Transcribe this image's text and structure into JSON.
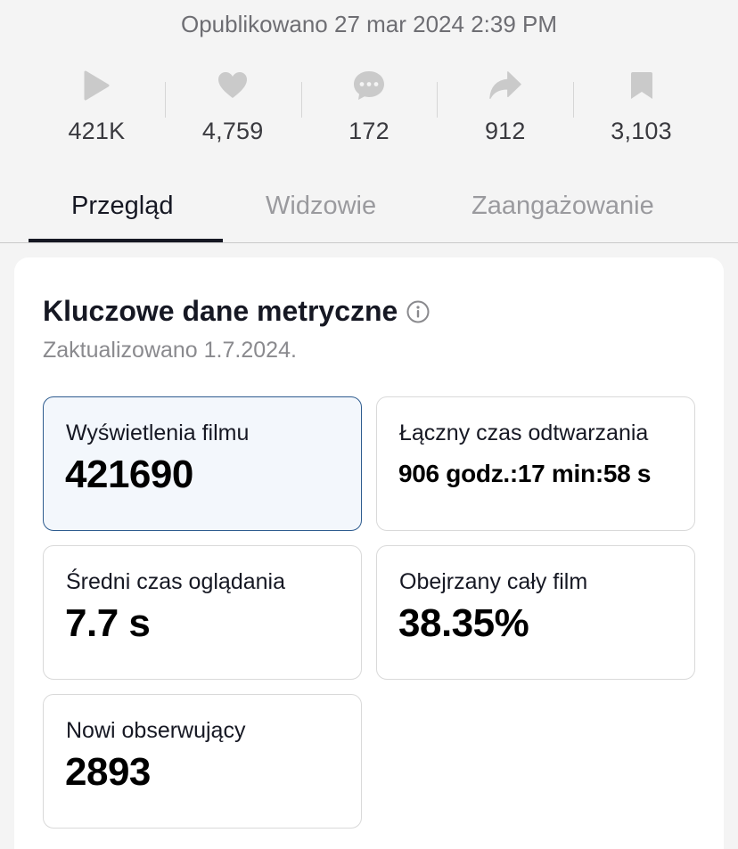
{
  "header": {
    "published": "Opublikowano 27 mar 2024 2:39 PM"
  },
  "stats": [
    {
      "icon": "play-icon",
      "value": "421K"
    },
    {
      "icon": "heart-icon",
      "value": "4,759"
    },
    {
      "icon": "comment-icon",
      "value": "172"
    },
    {
      "icon": "share-icon",
      "value": "912"
    },
    {
      "icon": "bookmark-icon",
      "value": "3,103"
    }
  ],
  "tabs": [
    {
      "label": "Przegląd",
      "active": true
    },
    {
      "label": "Widzowie",
      "active": false
    },
    {
      "label": "Zaangażowanie",
      "active": false
    }
  ],
  "key_metrics": {
    "title": "Kluczowe dane metryczne",
    "updated": "Zaktualizowano 1.7.2024.",
    "items": [
      {
        "label": "Wyświetlenia filmu",
        "value": "421690",
        "selected": true
      },
      {
        "label": "Łączny czas odtwarzania",
        "value": "906 godz.:17 min:58 s",
        "selected": false
      },
      {
        "label": "Średni czas oglądania",
        "value": "7.7 s",
        "selected": false
      },
      {
        "label": "Obejrzany cały film",
        "value": "38.35%",
        "selected": false
      },
      {
        "label": "Nowi obserwujący",
        "value": "2893",
        "selected": false
      }
    ]
  },
  "colors": {
    "icon": "#cacaca",
    "text_primary": "#161823",
    "text_muted": "#9a9a9e",
    "selected_border": "#2e5c8f",
    "selected_bg": "#f3f7fc"
  }
}
